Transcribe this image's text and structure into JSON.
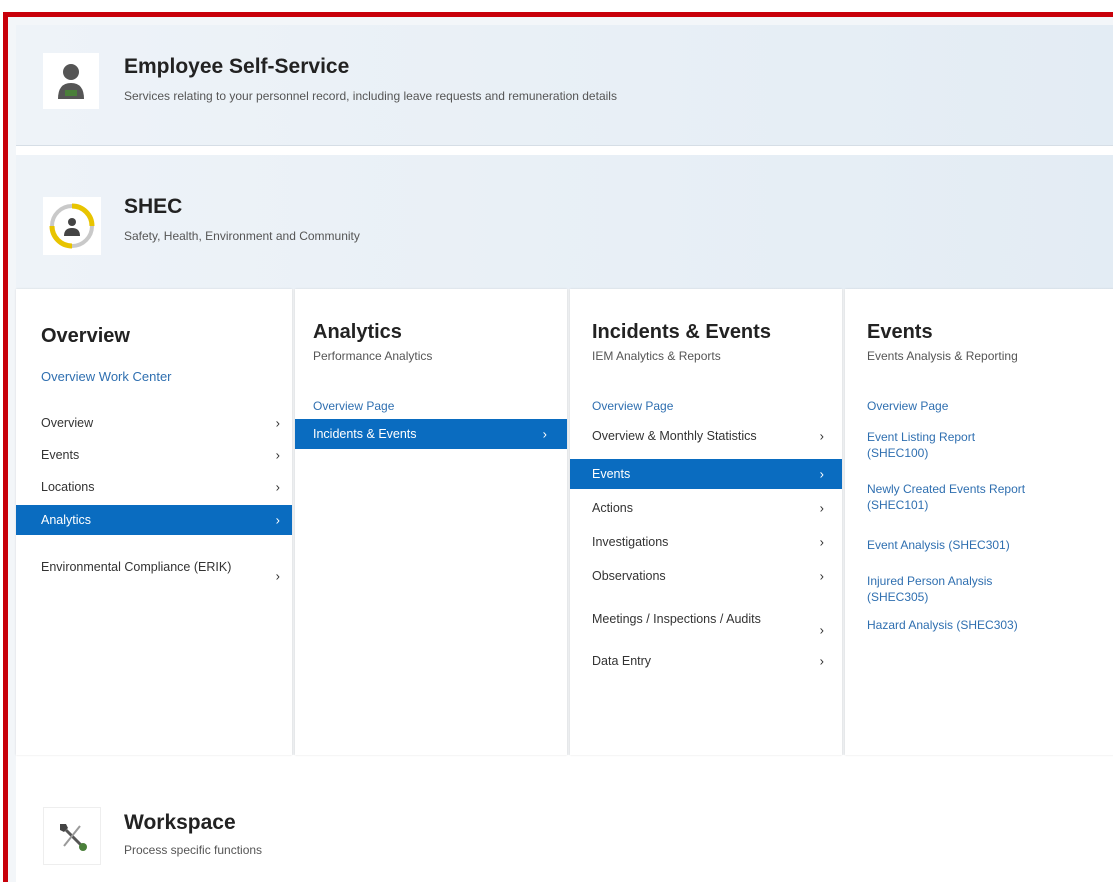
{
  "tiles": {
    "ess": {
      "title": "Employee Self-Service",
      "subtitle": "Services relating to your personnel record, including leave requests and remuneration details"
    },
    "shec": {
      "title": "SHEC",
      "subtitle": "Safety, Health, Environment and Community"
    },
    "workspace": {
      "title": "Workspace",
      "subtitle": "Process specific functions"
    }
  },
  "menu": {
    "overview": {
      "title": "Overview",
      "link": "Overview Work Center",
      "items": [
        {
          "label": "Overview",
          "chev": "›"
        },
        {
          "label": "Events",
          "chev": "›"
        },
        {
          "label": "Locations",
          "chev": "›"
        },
        {
          "label": "Analytics",
          "chev": "›"
        },
        {
          "label": "Environmental Compliance (ERIK)",
          "chev": "›"
        }
      ]
    },
    "analytics": {
      "title": "Analytics",
      "desc": "Performance Analytics",
      "link": "Overview Page",
      "items": [
        {
          "label": "Incidents & Events",
          "chev": "›"
        }
      ]
    },
    "incidents": {
      "title": "Incidents & Events",
      "desc": "IEM Analytics & Reports",
      "link": "Overview Page",
      "items": [
        {
          "label": "Overview & Monthly Statistics",
          "chev": "›"
        },
        {
          "label": "Events",
          "chev": "›"
        },
        {
          "label": "Actions",
          "chev": "›"
        },
        {
          "label": "Investigations",
          "chev": "›"
        },
        {
          "label": "Observations",
          "chev": "›"
        },
        {
          "label": "Meetings / Inspections / Audits",
          "chev": "›"
        },
        {
          "label": "Data Entry",
          "chev": "›"
        }
      ]
    },
    "events": {
      "title": "Events",
      "desc": "Events Analysis & Reporting",
      "link": "Overview Page",
      "links": [
        "Event Listing Report (SHEC100)",
        "Newly Created Events Report (SHEC101)",
        "Event Analysis (SHEC301)",
        "Injured Person Analysis (SHEC305)",
        "Hazard Analysis (SHEC303)"
      ]
    }
  },
  "colors": {
    "accent": "#0a6cc0",
    "frame": "#c8000a",
    "link": "#2f6fb0"
  },
  "icons": {
    "ess": "person-icon",
    "shec": "shec-logo-icon",
    "workspace": "tools-icon"
  }
}
